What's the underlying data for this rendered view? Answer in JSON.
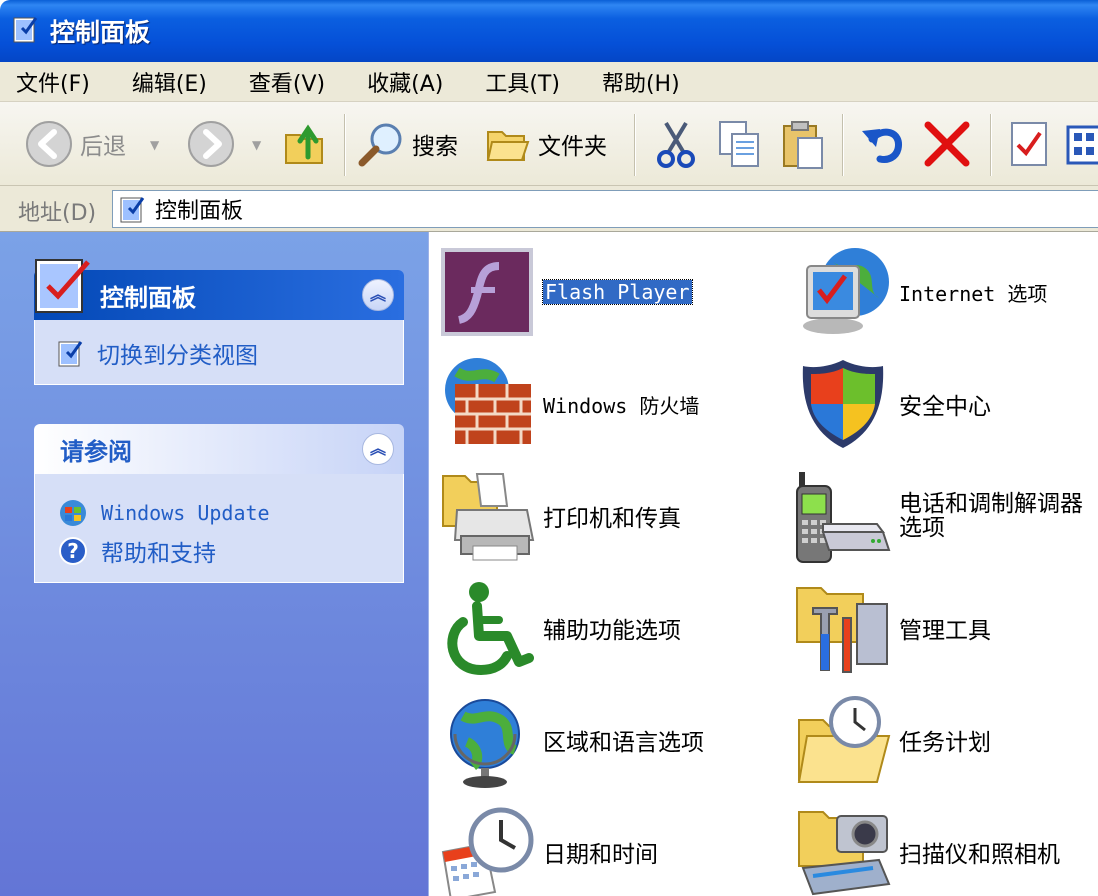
{
  "window": {
    "title": "控制面板"
  },
  "menu": {
    "items": [
      "文件(F)",
      "编辑(E)",
      "查看(V)",
      "收藏(A)",
      "工具(T)",
      "帮助(H)"
    ]
  },
  "toolbar": {
    "back_label": "后退",
    "search_label": "搜索",
    "folders_label": "文件夹"
  },
  "address": {
    "label": "地址(D)",
    "value": "控制面板"
  },
  "left_panels": {
    "control_panel": {
      "title": "控制面板",
      "links": [
        "切换到分类视图"
      ]
    },
    "see_also": {
      "title": "请参阅",
      "links": [
        "Windows Update",
        "帮助和支持"
      ]
    }
  },
  "items": [
    {
      "label": "Flash Player",
      "icon": "flash-player-icon",
      "selected": true
    },
    {
      "label": "Internet 选项",
      "icon": "internet-options-icon"
    },
    {
      "label": "Windows 防火墙",
      "icon": "firewall-icon"
    },
    {
      "label": "安全中心",
      "icon": "security-center-icon"
    },
    {
      "label": "打印机和传真",
      "icon": "printer-icon"
    },
    {
      "label": "电话和调制解调器选项",
      "icon": "phone-modem-icon"
    },
    {
      "label": "辅助功能选项",
      "icon": "accessibility-icon"
    },
    {
      "label": "管理工具",
      "icon": "admin-tools-icon"
    },
    {
      "label": "区域和语言选项",
      "icon": "regional-language-icon"
    },
    {
      "label": "任务计划",
      "icon": "scheduled-tasks-icon"
    },
    {
      "label": "日期和时间",
      "icon": "date-time-icon"
    },
    {
      "label": "扫描仪和照相机",
      "icon": "scanner-camera-icon"
    }
  ],
  "colors": {
    "titlebar": "#0550d8",
    "link": "#215dc6",
    "selection": "#316ac5",
    "taskpane": "#6f8be0"
  }
}
